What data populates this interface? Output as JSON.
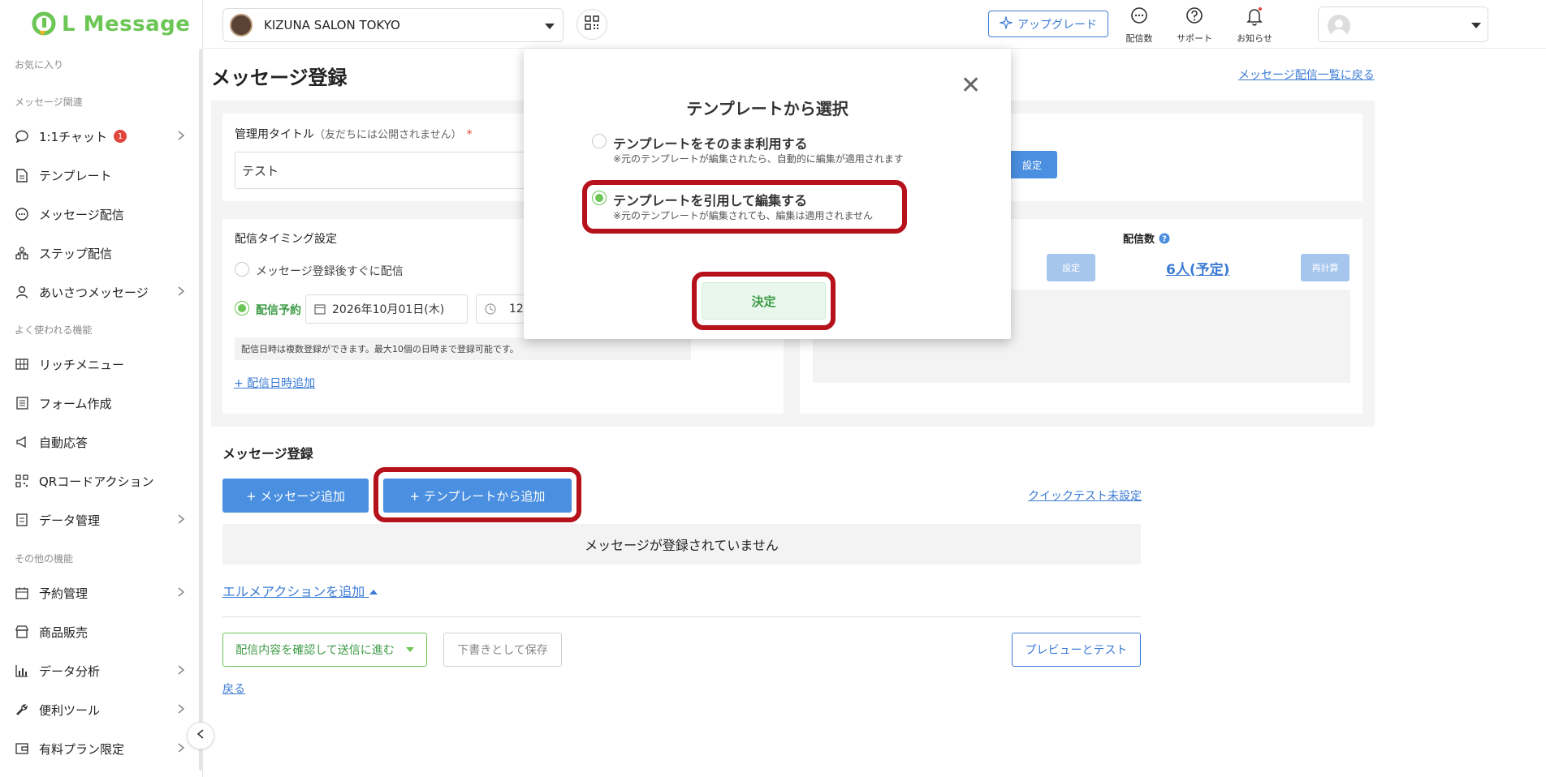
{
  "brand": {
    "name": "L Message",
    "color": "#6cc655"
  },
  "header": {
    "account_name": "KIZUNA SALON TOKYO",
    "upgrade_label": "アップグレード",
    "icons": [
      {
        "name": "delivery-count-icon",
        "label": "配信数"
      },
      {
        "name": "support-icon",
        "label": "サポート"
      },
      {
        "name": "notification-icon",
        "label": "お知らせ"
      }
    ]
  },
  "sidebar": {
    "sections": {
      "favorites": "お気に入り",
      "message": "メッセージ関連",
      "common": "よく使われる機能",
      "other": "その他の機能"
    },
    "items": {
      "chat": {
        "label": "1:1チャット",
        "badge": "1"
      },
      "template": {
        "label": "テンプレート"
      },
      "broadcast": {
        "label": "メッセージ配信"
      },
      "step": {
        "label": "ステップ配信"
      },
      "greeting": {
        "label": "あいさつメッセージ"
      },
      "richmenu": {
        "label": "リッチメニュー"
      },
      "form": {
        "label": "フォーム作成"
      },
      "autoreply": {
        "label": "自動応答"
      },
      "qr": {
        "label": "QRコードアクション"
      },
      "data": {
        "label": "データ管理"
      },
      "reservation": {
        "label": "予約管理"
      },
      "sales": {
        "label": "商品販売"
      },
      "analytics": {
        "label": "データ分析"
      },
      "tools": {
        "label": "便利ツール"
      },
      "paid": {
        "label": "有料プラン限定"
      }
    }
  },
  "page": {
    "title": "メッセージ登録",
    "back_to_list": "メッセージ配信一覧に戻る",
    "admin_title_label": "管理用タイトル",
    "admin_title_note": "（友だちには公開されません）",
    "admin_title_required": "*",
    "admin_title_value": "テスト",
    "set_button": "設定",
    "timing_label": "配信タイミング設定",
    "timing_immediate": "メッセージ登録後すぐに配信",
    "timing_scheduled": "配信予約",
    "date_value": "2026年10月01日(木)",
    "time_value": "12",
    "timing_note": "配信日時は複数登録ができます。最大10個の日時まで登録可能です。",
    "add_datetime": "+ 配信日時追加",
    "count_label": "配信数",
    "count_set": "設定",
    "count_value": "6人(予定)",
    "recalc": "再計算",
    "message_section": "メッセージ登録",
    "add_message": "+ メッセージ追加",
    "add_from_template": "+ テンプレートから追加",
    "quick_test": "クイックテスト未設定",
    "empty_message": "メッセージが登録されていません",
    "add_action": "エルメアクションを追加",
    "confirm_send": "配信内容を確認して送信に進む",
    "save_draft": "下書きとして保存",
    "preview_test": "プレビューとテスト",
    "back": "戻る"
  },
  "modal": {
    "title": "テンプレートから選択",
    "option1_title": "テンプレートをそのまま利用する",
    "option1_note": "※元のテンプレートが編集されたら、自動的に編集が適用されます",
    "option2_title": "テンプレートを引用して編集する",
    "option2_note": "※元のテンプレートが編集されても、編集は適用されません",
    "selected_option": "option2",
    "confirm": "決定"
  },
  "colors": {
    "accent_blue": "#4a8fe0",
    "green": "#6cc655",
    "highlight_red": "#b5121b",
    "badge_red": "#e0463c"
  }
}
